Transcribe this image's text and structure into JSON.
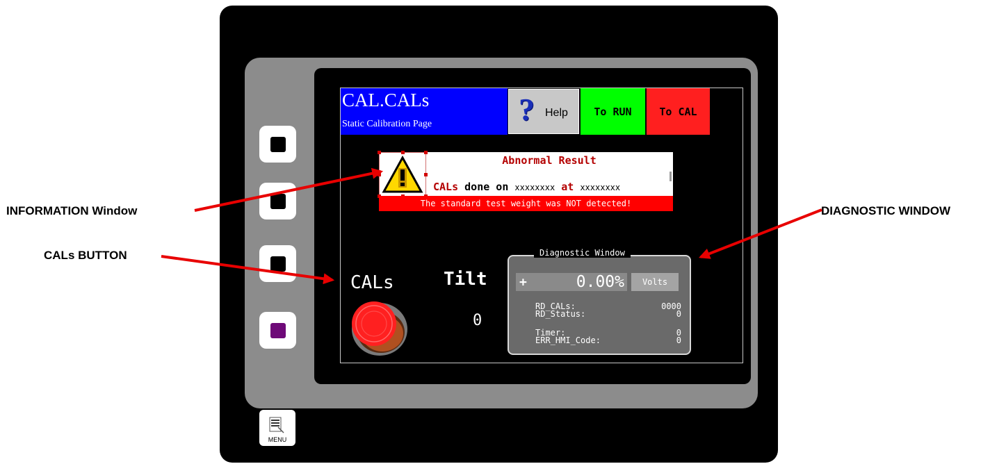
{
  "header": {
    "title": "CAL.CALs",
    "subtitle": "Static Calibration Page",
    "help_label": "Help",
    "to_run_label": "To RUN",
    "to_cal_label": "To CAL"
  },
  "info_window": {
    "title": "Abnormal Result",
    "line_prefix": "CALs",
    "line_mid": "done on",
    "date_placeholder": "xxxxxxxx",
    "line_at": "at",
    "time_placeholder": "xxxxxxxx",
    "banner": "The standard test weight was NOT detected!",
    "icon": "warning-icon"
  },
  "cals": {
    "label": "CALs",
    "button_icon": "red-push-button-icon"
  },
  "tilt": {
    "label": "Tilt",
    "value": "0"
  },
  "diagnostic": {
    "title": "Diagnostic Window",
    "sign": "+",
    "value": "0.00%",
    "unit": "Volts",
    "rows": [
      {
        "label": "RD_CALs:",
        "value": "0000"
      },
      {
        "label": "RD_Status:",
        "value": "0"
      },
      {
        "label": "Timer:",
        "value": "0"
      },
      {
        "label": "ERR_HMI_Code:",
        "value": "0"
      }
    ]
  },
  "device": {
    "menu_label": "MENU",
    "menu_icon": "menu-document-icon"
  },
  "annotations": {
    "information": "INFORMATION Window",
    "cals_button": "CALs BUTTON",
    "diagnostic": "DIAGNOSTIC WINDOW"
  },
  "colors": {
    "title_bg": "#0000ff",
    "run_bg": "#00ff00",
    "cal_bg": "#ff1f1f",
    "alert_red": "#ff0000",
    "arrow_red": "#e80000"
  }
}
